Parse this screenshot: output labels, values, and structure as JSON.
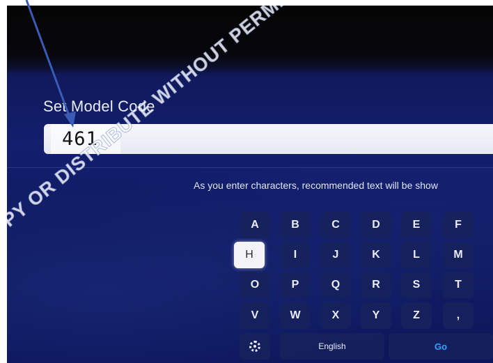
{
  "screen": {
    "field_title": "Set Model Code",
    "input_value": "461",
    "hint": "As you enter characters, recommended text will be show"
  },
  "keyboard": {
    "rows": [
      [
        "A",
        "B",
        "C",
        "D",
        "E",
        "F"
      ],
      [
        "H",
        "I",
        "J",
        "K",
        "L",
        "M"
      ],
      [
        "O",
        "P",
        "Q",
        "R",
        "S",
        "T"
      ],
      [
        "V",
        "W",
        "X",
        "Y",
        "Z",
        ","
      ]
    ],
    "focused_key": "H",
    "settings_icon": "gear-icon",
    "language_label": "English",
    "go_label": "Go"
  },
  "overlay": {
    "watermark": "PY OR DISTRIBUTE WITHOUT PERMISSION",
    "annotation_arrow_color": "#3a5bb5"
  },
  "colors": {
    "tv_background": "#131f6e",
    "key_background": "#16225c",
    "focused_key": "#f4f4f6",
    "go_text": "#3aa0ff"
  }
}
